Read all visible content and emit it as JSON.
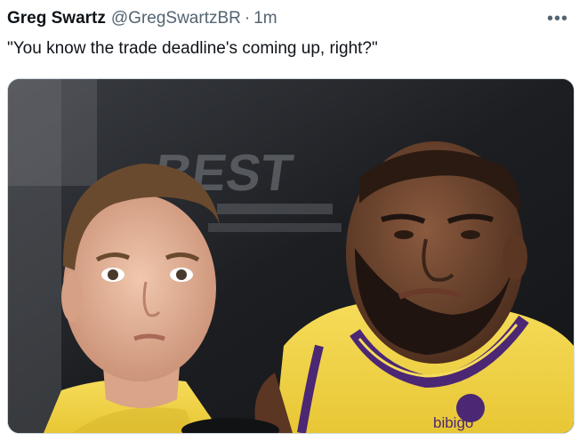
{
  "tweet": {
    "author_name": "Greg Swartz",
    "author_handle": "@GregSwartzBR",
    "separator": "·",
    "timestamp": "1m",
    "text": "\"You know the trade deadline's coming up, right?\"",
    "more_icon": "more-horizontal-icon"
  },
  "media": {
    "background_sign_text": "BEST",
    "jersey_sponsor": "bibigo",
    "colors": {
      "lakers_gold": "#f3d447",
      "lakers_purple": "#4b2774",
      "dark_bg": "#1f2226"
    }
  }
}
